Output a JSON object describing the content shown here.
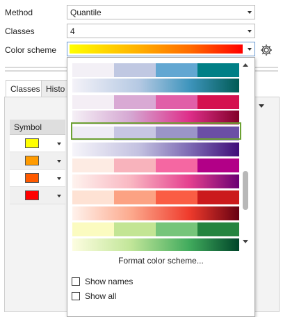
{
  "form": {
    "method_label": "Method",
    "method_value": "Quantile",
    "classes_label": "Classes",
    "classes_value": "4",
    "color_scheme_label": "Color scheme"
  },
  "tabs": {
    "classes": "Classes",
    "histogram": "Histo"
  },
  "table": {
    "symbol_header": "Symbol",
    "rows": [
      {
        "color": "#ffff00"
      },
      {
        "color": "#ff9b00"
      },
      {
        "color": "#ff5a00"
      },
      {
        "color": "#ff0000"
      }
    ]
  },
  "dropdown": {
    "format_link": "Format color scheme...",
    "show_names_label": "Show names",
    "show_all_label": "Show all",
    "selected_ramp_colors": [
      "#eeecf5",
      "#c7c6e3",
      "#9b95c8",
      "#6b4fa6"
    ]
  },
  "icons": {
    "settings": "gear-icon",
    "dropdown": "chevron-down-icon"
  },
  "colors": {
    "selection_outline": "#6ca133"
  }
}
